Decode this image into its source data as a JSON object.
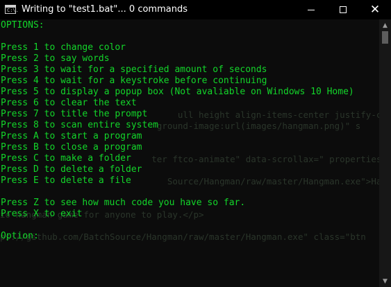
{
  "window": {
    "title": "Writing to \"test1.bat\"... 0 commands",
    "icon_text": "C:\\.",
    "controls": {
      "minimize": "minimize",
      "maximize": "maximize",
      "close": "✕"
    }
  },
  "colors": {
    "text": "#13d62a",
    "ghost": "#2e3a2e",
    "background": "#0c0c0c"
  },
  "console": {
    "lines": [
      "OPTIONS:",
      "",
      "Press 1 to change color",
      "Press 2 to say words",
      "Press 3 to wait for a specified amount of seconds",
      "Press 4 to wait for a keystroke before continuing",
      "Press 5 to display a popup box (Not avaliable on Windows 10 Home)",
      "Press 6 to clear the text",
      "Press 7 to title the prompt",
      "Press 8 to scan entire system",
      "Press A to start a program",
      "Press B to close a program",
      "Press C to make a folder",
      "Press D to delete a folder",
      "Press E to delete a file",
      "",
      "Press Z to see how much code you have so far.",
      "Press X to exit",
      "",
      "Option:"
    ],
    "ghost_lines": [
      "                                  ull height align-items-center justify-content",
      "                              ground-image:url(images/hangman.png)\" s",
      "                             ter ftco-animate\" data-scrollax=\" properties:",
      "                                Source/Hangman/raw/master/Hangman.exe\">Hangman-T",
      "io hangman game for anyone to play.</p>",
      "ps://github.com/BatchSource/Hangman/raw/master/Hangman.exe\" class=\"btn"
    ]
  }
}
